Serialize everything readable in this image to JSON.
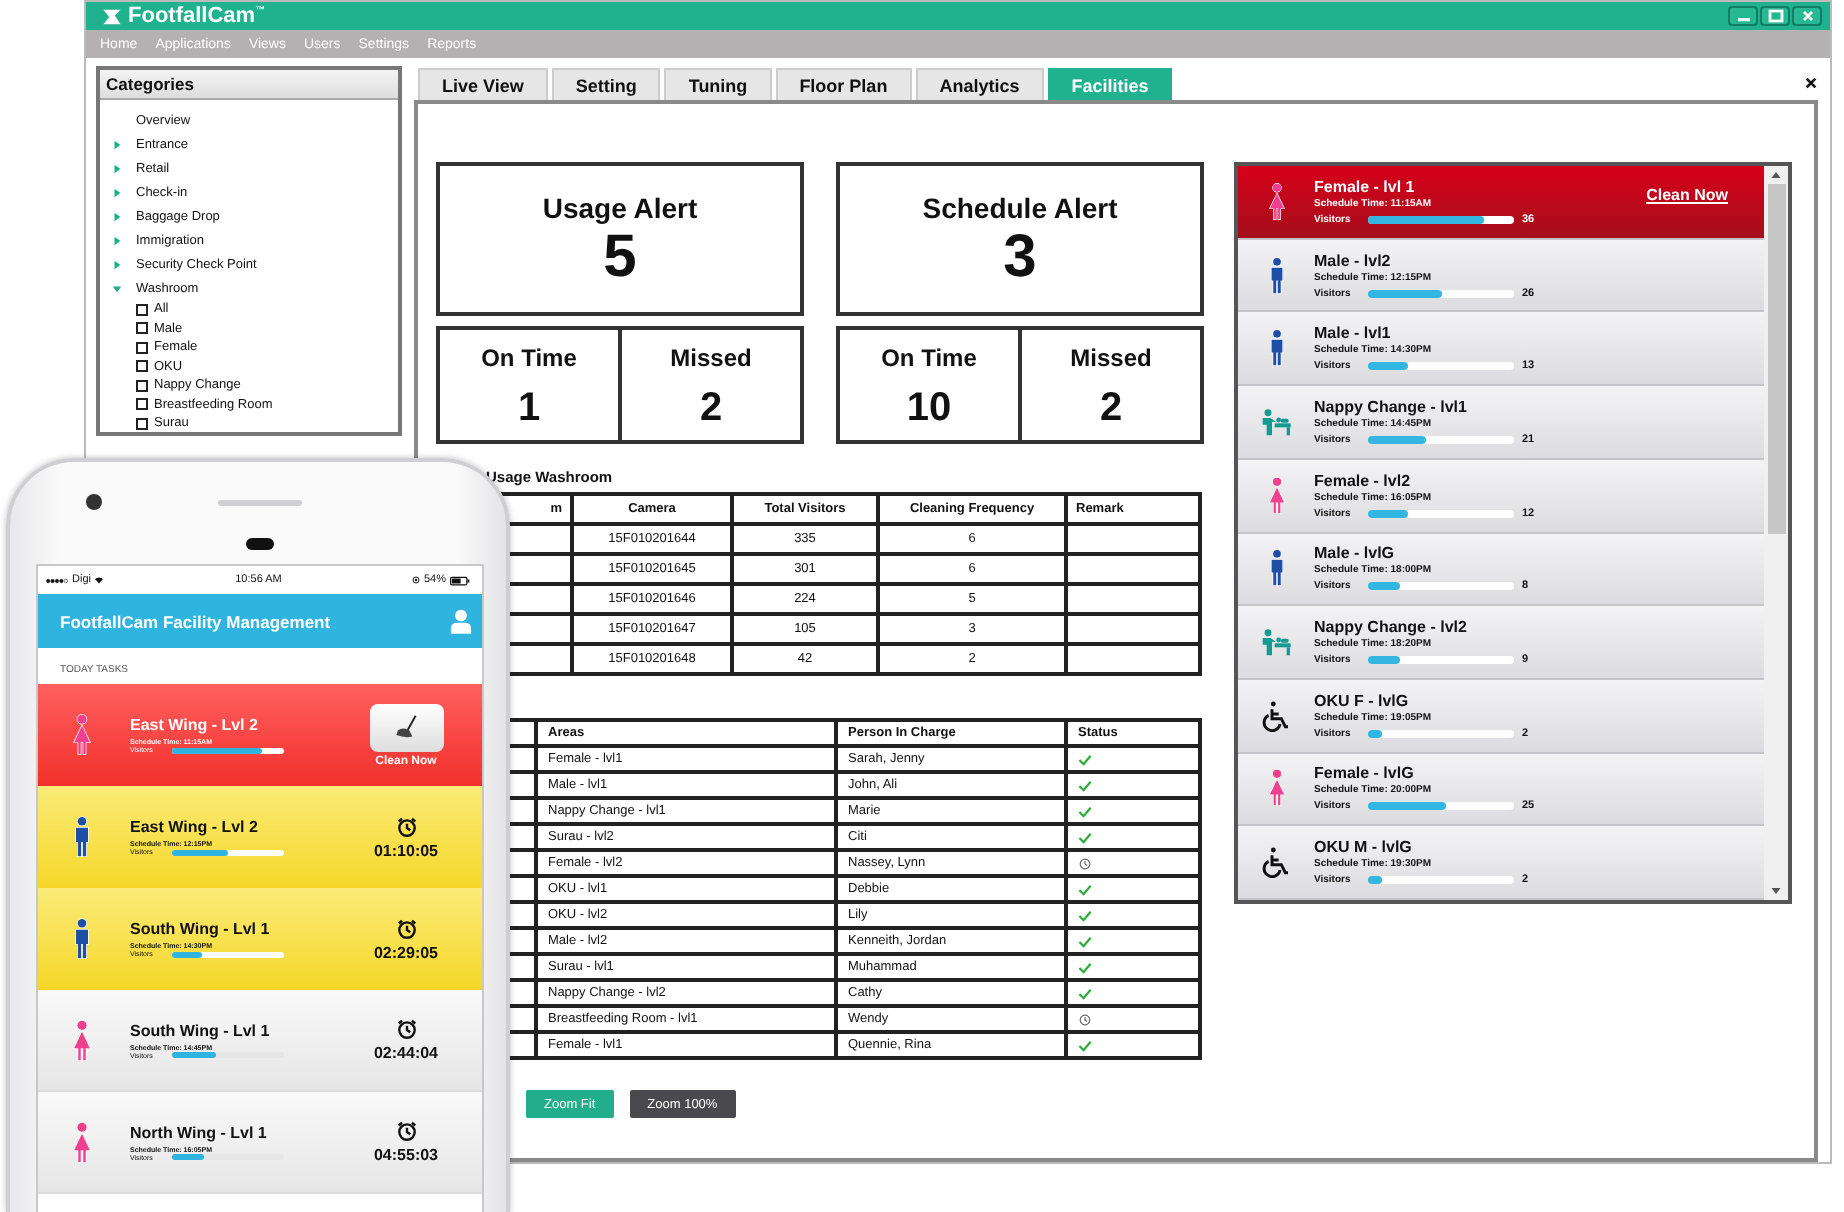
{
  "window": {
    "logo": "FootfallCam$^{™}$"
  },
  "menu": [
    "Home",
    "Applications",
    "Views",
    "Users",
    "Settings",
    "Reports"
  ],
  "categories": {
    "title": "Categories",
    "items": [
      {
        "label": "Overview",
        "kind": "plain"
      },
      {
        "label": "Entrance",
        "kind": "group",
        "expanded": false
      },
      {
        "label": "Retail",
        "kind": "group",
        "expanded": false
      },
      {
        "label": "Check-in",
        "kind": "group",
        "expanded": false
      },
      {
        "label": "Baggage Drop",
        "kind": "group",
        "expanded": false
      },
      {
        "label": "Immigration",
        "kind": "group",
        "expanded": false
      },
      {
        "label": "Security Check Point",
        "kind": "group",
        "expanded": false
      },
      {
        "label": "Washroom",
        "kind": "group",
        "expanded": true,
        "children": [
          {
            "label": "All",
            "checked": false
          },
          {
            "label": "Male",
            "checked": false
          },
          {
            "label": "Female",
            "checked": false
          },
          {
            "label": "OKU",
            "checked": false
          },
          {
            "label": "Nappy Change",
            "checked": false
          },
          {
            "label": "Breastfeeding Room",
            "checked": false
          },
          {
            "label": "Surau",
            "checked": false
          }
        ]
      }
    ]
  },
  "tabs": [
    {
      "label": "Live View",
      "selected": false
    },
    {
      "label": "Setting",
      "selected": false
    },
    {
      "label": "Tuning",
      "selected": false
    },
    {
      "label": "Floor Plan",
      "selected": false
    },
    {
      "label": "Analytics",
      "selected": false
    },
    {
      "label": "Facilities",
      "selected": true
    }
  ],
  "alerts": [
    {
      "title": "Usage Alert",
      "value": "5",
      "stats": [
        {
          "label": "On Time",
          "value": "1"
        },
        {
          "label": "Missed",
          "value": "2"
        }
      ]
    },
    {
      "title": "Schedule Alert",
      "value": "3",
      "stats": [
        {
          "label": "On Time",
          "value": "10"
        },
        {
          "label": "Missed",
          "value": "2"
        }
      ]
    }
  ],
  "usage_table": {
    "title": "Usage Washroom",
    "columns": [
      "m",
      "Camera",
      "Total Visitors",
      "Cleaning Frequency",
      "Remark"
    ],
    "rows": [
      {
        "camera": "15F010201644",
        "total_visitors": "335",
        "cleaning_frequency": "6"
      },
      {
        "camera": "15F010201645",
        "total_visitors": "301",
        "cleaning_frequency": "6"
      },
      {
        "camera": "15F010201646",
        "total_visitors": "224",
        "cleaning_frequency": "5"
      },
      {
        "camera": "15F010201647",
        "total_visitors": "105",
        "cleaning_frequency": "3"
      },
      {
        "camera": "15F010201648",
        "total_visitors": "42",
        "cleaning_frequency": "2"
      }
    ]
  },
  "schedule_table": {
    "columns": [
      "Areas",
      "Person In Charge",
      "Status"
    ],
    "rows": [
      {
        "area": "Female - lvl1",
        "person": "Sarah, Jenny",
        "completed": true
      },
      {
        "area": "Male - lvl1",
        "person": "John, Ali",
        "completed": true
      },
      {
        "area": "Nappy Change - lvl1",
        "person": "Marie",
        "completed": true
      },
      {
        "area": "Surau - lvl2",
        "person": "Citi",
        "completed": true
      },
      {
        "area": "Female - lvl2",
        "person": "Nassey, Lynn",
        "completed": false
      },
      {
        "area": "OKU - lvl1",
        "person": "Debbie",
        "completed": true
      },
      {
        "area": "OKU - lvl2",
        "person": "Lily",
        "completed": true
      },
      {
        "area": "Male - lvl2",
        "person": "Kenneith, Jordan",
        "completed": true
      },
      {
        "area": "Surau - lvl1",
        "person": "Muhammad",
        "completed": true
      },
      {
        "area": "Nappy Change - lvl2",
        "person": "Cathy",
        "completed": true
      },
      {
        "area": "Breastfeeding Room - lvl1",
        "person": "Wendy",
        "completed": false
      },
      {
        "area": "Female - lvl1",
        "person": "Quennie, Rina",
        "completed": true
      }
    ]
  },
  "zoom_buttons": [
    {
      "label": "Zoom Fit",
      "kind": "primary"
    },
    {
      "label": "Zoom 100%",
      "kind": "secondary"
    }
  ],
  "facilities": [
    {
      "kind": "female",
      "name": "Female - lvl 1",
      "schedule": "Schedule Time: 11:15AM",
      "visitors_label": "Visitors",
      "level": 0.8,
      "count": "36",
      "alert": true,
      "action": "Clean Now"
    },
    {
      "kind": "male",
      "name": "Male - lvl2",
      "schedule": "Schedule Time: 12:15PM",
      "visitors_label": "Visitors",
      "level": 0.5,
      "count": "26",
      "alert": false
    },
    {
      "kind": "male",
      "name": "Male - lvl1",
      "schedule": "Schedule Time: 14:30PM",
      "visitors_label": "Visitors",
      "level": 0.27,
      "count": "13",
      "alert": false
    },
    {
      "kind": "nappy",
      "name": "Nappy Change - lvl1",
      "schedule": "Schedule Time: 14:45PM",
      "visitors_label": "Visitors",
      "level": 0.4,
      "count": "21",
      "alert": false
    },
    {
      "kind": "female",
      "name": "Female - lvl2",
      "schedule": "Schedule Time: 16:05PM",
      "visitors_label": "Visitors",
      "level": 0.28,
      "count": "12",
      "alert": false
    },
    {
      "kind": "male",
      "name": "Male - lvlG",
      "schedule": "Schedule Time: 18:00PM",
      "visitors_label": "Visitors",
      "level": 0.22,
      "count": "8",
      "alert": false
    },
    {
      "kind": "nappy",
      "name": "Nappy Change - lvl2",
      "schedule": "Schedule Time: 18:20PM",
      "visitors_label": "Visitors",
      "level": 0.22,
      "count": "9",
      "alert": false
    },
    {
      "kind": "wheelchair",
      "name": "OKU F - lvlG",
      "schedule": "Schedule Time: 19:05PM",
      "visitors_label": "Visitors",
      "level": 0.1,
      "count": "2",
      "alert": false
    },
    {
      "kind": "female",
      "name": "Female - lvlG",
      "schedule": "Schedule Time: 20:00PM",
      "visitors_label": "Visitors",
      "level": 0.53,
      "count": "25",
      "alert": false
    },
    {
      "kind": "wheelchair",
      "name": "OKU M - lvlG",
      "schedule": "Schedule Time: 19:30PM",
      "visitors_label": "Visitors",
      "level": 0.1,
      "count": "2",
      "alert": false
    }
  ],
  "phone": {
    "carrier": "Digi",
    "time": "10:56 AM",
    "battery": "54%",
    "app_title": "FootfallCam Facility Management",
    "section": "TODAY TASKS",
    "tasks": [
      {
        "overdue": true,
        "kind": "female",
        "name": "East Wing - Lvl 2",
        "schedule": "Schedule Time: 11:15AM",
        "visitors_label": "Visitors",
        "level": 0.8,
        "action": "Clean Now"
      },
      {
        "overdue": false,
        "due_soon": true,
        "kind": "male",
        "name": "East Wing - Lvl 2",
        "schedule": "Schedule Time: 12:15PM",
        "visitors_label": "Visitors",
        "level": 0.5,
        "timer": "01:10:05"
      },
      {
        "overdue": false,
        "due_soon": true,
        "kind": "male",
        "name": "South Wing - Lvl 1",
        "schedule": "Schedule Time: 14:30PM",
        "visitors_label": "Visitors",
        "level": 0.27,
        "timer": "02:29:05"
      },
      {
        "overdue": false,
        "due_soon": false,
        "kind": "female",
        "name": "South Wing - Lvl 1",
        "schedule": "Schedule Time: 14:45PM",
        "visitors_label": "Visitors",
        "level": 0.4,
        "timer": "02:44:04"
      },
      {
        "overdue": false,
        "due_soon": false,
        "kind": "female",
        "name": "North Wing - Lvl 1",
        "schedule": "Schedule Time: 16:05PM",
        "visitors_label": "Visitors",
        "level": 0.28,
        "timer": "04:55:03"
      }
    ]
  }
}
